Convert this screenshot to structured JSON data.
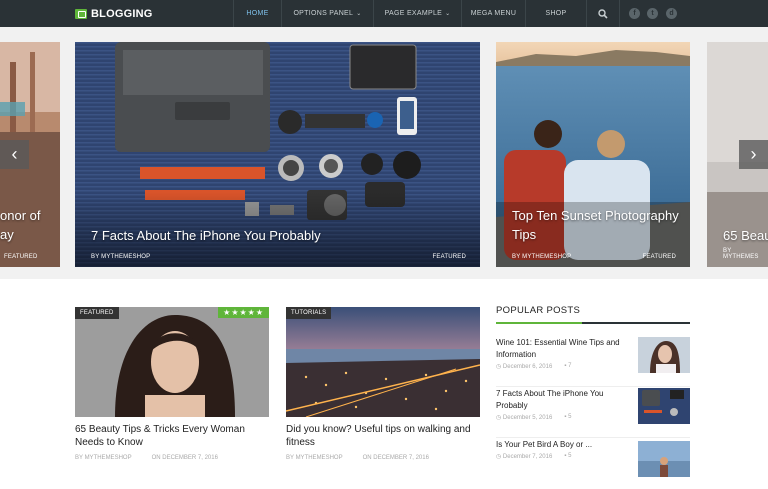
{
  "nav": {
    "logo": "BLOGGING",
    "items": [
      {
        "label": "HOME",
        "active": true,
        "dropdown": false
      },
      {
        "label": "OPTIONS PANEL",
        "active": false,
        "dropdown": true
      },
      {
        "label": "PAGE EXAMPLE",
        "active": false,
        "dropdown": true
      },
      {
        "label": "MEGA MENU",
        "active": false,
        "dropdown": false
      },
      {
        "label": "SHOP",
        "active": false,
        "dropdown": false
      }
    ],
    "social": [
      "f",
      "t",
      "d"
    ]
  },
  "slider": {
    "left_partial": {
      "title": "onor of\nay",
      "category": "FEATURED"
    },
    "main": {
      "title": "7 Facts About The iPhone You Probably",
      "author": "BY MYTHEMESHOP",
      "category": "FEATURED"
    },
    "second": {
      "title": "Top Ten Sunset Photography Tips",
      "author": "BY MYTHEMESHOP",
      "category": "FEATURED"
    },
    "right_partial": {
      "title": "65 Beau",
      "author": "BY MYTHEMES"
    },
    "prev": "‹",
    "next": "›"
  },
  "cards": [
    {
      "badge": "FEATURED",
      "stars": "★★★★★",
      "title": "65 Beauty Tips & Tricks Every Woman Needs to Know",
      "author": "BY MYTHEMESHOP",
      "date": "ON DECEMBER 7, 2016"
    },
    {
      "badge": "TUTORIALS",
      "title": "Did you know? Useful tips on walking and fitness",
      "author": "BY MYTHEMESHOP",
      "date": "ON DECEMBER 7, 2016"
    }
  ],
  "popular": {
    "heading": "POPULAR POSTS",
    "items": [
      {
        "title": "Wine 101: Essential Wine Tips and Information",
        "date": "December 6, 2016",
        "comments": "7"
      },
      {
        "title": "7 Facts About The iPhone You Probably",
        "date": "December 5, 2016",
        "comments": "5"
      },
      {
        "title": "Is Your Pet Bird A Boy or ...",
        "date": "December 7, 2016",
        "comments": "5"
      }
    ]
  }
}
